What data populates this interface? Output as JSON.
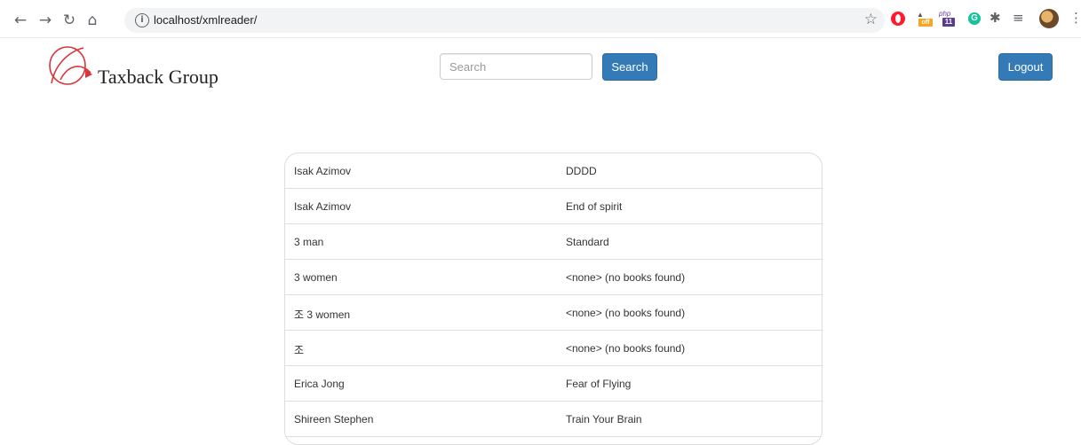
{
  "browser": {
    "url": "localhost/xmlreader/",
    "icons": {
      "back": "back-arrow-icon",
      "forward": "forward-arrow-icon",
      "reload": "reload-icon",
      "home": "home-icon",
      "info": "info-icon",
      "bookmark": "star-icon",
      "menu": "menu-dots-icon"
    },
    "extensions": {
      "off_tag": "off",
      "php_label": "php",
      "php_version": "11",
      "grammarly": "G"
    }
  },
  "header": {
    "brand": "Taxback Group",
    "search_placeholder": "Search",
    "search_button": "Search",
    "logout_button": "Logout"
  },
  "colors": {
    "primary": "#337ab7",
    "logo_red": "#d9343a"
  },
  "books": [
    {
      "author": "Isak Azimov",
      "title": "DDDD"
    },
    {
      "author": "Isak Azimov",
      "title": "End of spirit"
    },
    {
      "author": "3 man",
      "title": "Standard"
    },
    {
      "author": "3 women",
      "title": "<none> (no books found)"
    },
    {
      "author": "조 3 women",
      "title": "<none> (no books found)"
    },
    {
      "author": "조",
      "title": "<none> (no books found)"
    },
    {
      "author": "Erica Jong",
      "title": "Fear of Flying"
    },
    {
      "author": "Shireen Stephen",
      "title": "Train Your Brain"
    }
  ]
}
